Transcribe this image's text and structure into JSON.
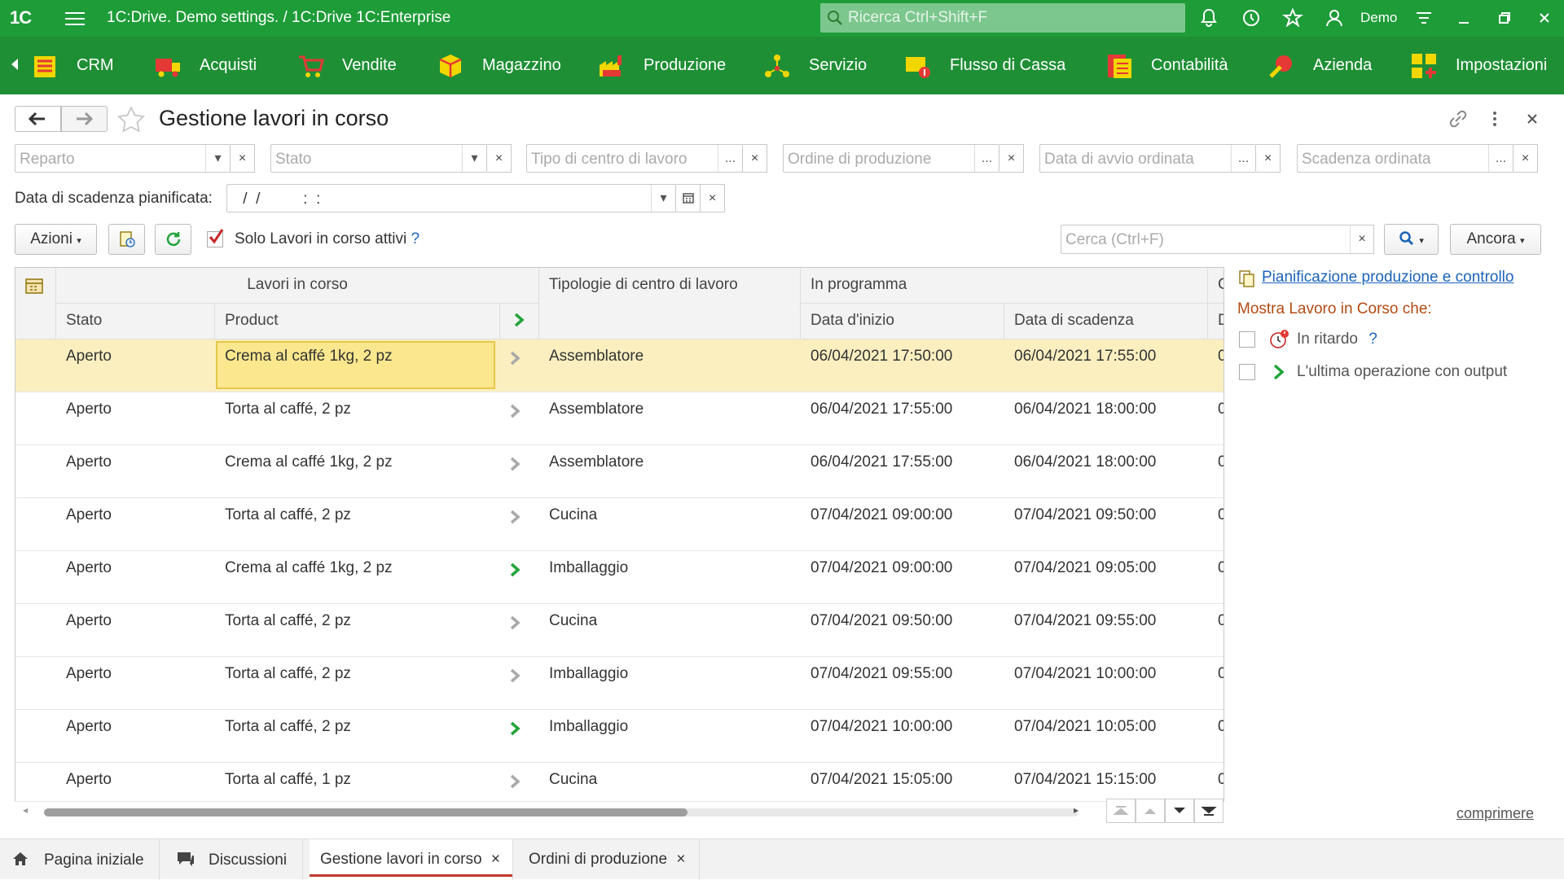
{
  "titlebar": {
    "logo": "1C",
    "title": "1C:Drive. Demo settings. / 1C:Drive 1C:Enterprise",
    "search_placeholder": "Ricerca Ctrl+Shift+F",
    "user": "Demo",
    "icons": [
      "bell-icon",
      "history-icon",
      "star-icon",
      "user-icon",
      "menu-lines-icon",
      "minimize-icon",
      "restore-icon",
      "close-icon"
    ]
  },
  "sections": [
    {
      "label": "CRM",
      "icon": "crm-icon"
    },
    {
      "label": "Acquisti",
      "icon": "truck-icon"
    },
    {
      "label": "Vendite",
      "icon": "cart-icon"
    },
    {
      "label": "Magazzino",
      "icon": "box-icon"
    },
    {
      "label": "Produzione",
      "icon": "factory-icon"
    },
    {
      "label": "Servizio",
      "icon": "service-icon"
    },
    {
      "label": "Flusso di Cassa",
      "icon": "cash-icon"
    },
    {
      "label": "Contabilità",
      "icon": "ledger-icon"
    },
    {
      "label": "Azienda",
      "icon": "company-icon"
    },
    {
      "label": "Impostazioni",
      "icon": "settings-icon"
    }
  ],
  "form": {
    "title": "Gestione lavori in corso"
  },
  "filters": {
    "reparto": "Reparto",
    "stato": "Stato",
    "tipo": "Tipo di centro di lavoro",
    "ordine": "Ordine di produzione",
    "data_avvio": "Data di avvio ordinata",
    "scadenza": "Scadenza ordinata",
    "date_label": "Data di scadenza pianificata:",
    "date_value": " /  /          :  :",
    "ellipsis": "...",
    "clear": "×",
    "dropdown": "▾"
  },
  "toolbar": {
    "azioni": "Azioni",
    "only_active": "Solo Lavori in corso attivi",
    "help": "?",
    "search_placeholder": "Cerca (Ctrl+F)",
    "ancora": "Ancora"
  },
  "grid": {
    "group_header": "Lavori in corso",
    "col_tipologie": "Tipologie di centro di lavoro",
    "col_in_programma": "In programma",
    "col_stato": "Stato",
    "col_product": "Product",
    "col_data_inizio": "Data d'inizio",
    "col_data_scadenza": "Data di scadenza",
    "col_cut_top": "C",
    "col_cut_bottom": "D",
    "rows": [
      {
        "stato": "Aperto",
        "product": "Crema al caffé 1kg, 2 pz",
        "tipo": "Assemblatore",
        "inizio": "06/04/2021 17:50:00",
        "scadenza": "06/04/2021 17:55:00",
        "extra": "0",
        "arrow": "grey"
      },
      {
        "stato": "Aperto",
        "product": "Torta al caffé, 2 pz",
        "tipo": "Assemblatore",
        "inizio": "06/04/2021 17:55:00",
        "scadenza": "06/04/2021 18:00:00",
        "extra": "0",
        "arrow": "grey"
      },
      {
        "stato": "Aperto",
        "product": "Crema al caffé 1kg, 2 pz",
        "tipo": "Assemblatore",
        "inizio": "06/04/2021 17:55:00",
        "scadenza": "06/04/2021 18:00:00",
        "extra": "0",
        "arrow": "grey"
      },
      {
        "stato": "Aperto",
        "product": "Torta al caffé, 2 pz",
        "tipo": "Cucina",
        "inizio": "07/04/2021 09:00:00",
        "scadenza": "07/04/2021 09:50:00",
        "extra": "0",
        "arrow": "grey"
      },
      {
        "stato": "Aperto",
        "product": "Crema al caffé 1kg, 2 pz",
        "tipo": "Imballaggio",
        "inizio": "07/04/2021 09:00:00",
        "scadenza": "07/04/2021 09:05:00",
        "extra": "0",
        "arrow": "green"
      },
      {
        "stato": "Aperto",
        "product": "Torta al caffé, 2 pz",
        "tipo": "Cucina",
        "inizio": "07/04/2021 09:50:00",
        "scadenza": "07/04/2021 09:55:00",
        "extra": "0",
        "arrow": "grey"
      },
      {
        "stato": "Aperto",
        "product": "Torta al caffé, 2 pz",
        "tipo": "Imballaggio",
        "inizio": "07/04/2021 09:55:00",
        "scadenza": "07/04/2021 10:00:00",
        "extra": "0",
        "arrow": "grey"
      },
      {
        "stato": "Aperto",
        "product": "Torta al caffé, 2 pz",
        "tipo": "Imballaggio",
        "inizio": "07/04/2021 10:00:00",
        "scadenza": "07/04/2021 10:05:00",
        "extra": "0",
        "arrow": "green"
      },
      {
        "stato": "Aperto",
        "product": "Torta al caffé, 1 pz",
        "tipo": "Cucina",
        "inizio": "07/04/2021 15:05:00",
        "scadenza": "07/04/2021 15:15:00",
        "extra": "0",
        "arrow": "grey"
      }
    ]
  },
  "side": {
    "link": "Pianificazione produzione e controllo",
    "header": "Mostra Lavoro in Corso che:",
    "opt1": "In ritardo",
    "opt1_help": "?",
    "opt2": "L'ultima operazione con output",
    "collapse": "comprimere"
  },
  "tabs": [
    {
      "label": "Pagina iniziale",
      "icon": "home-icon"
    },
    {
      "label": "Discussioni",
      "icon": "chat-icon"
    },
    {
      "label": "Gestione lavori in corso",
      "close": "×",
      "active": true
    },
    {
      "label": "Ordini di produzione",
      "close": "×"
    }
  ],
  "colors": {
    "brand": "#1e9c38",
    "sections": "#1f8f35",
    "selected_row": "#fbefc0",
    "accent_yellow": "#f2d600",
    "green_arrow": "#23a33a"
  }
}
